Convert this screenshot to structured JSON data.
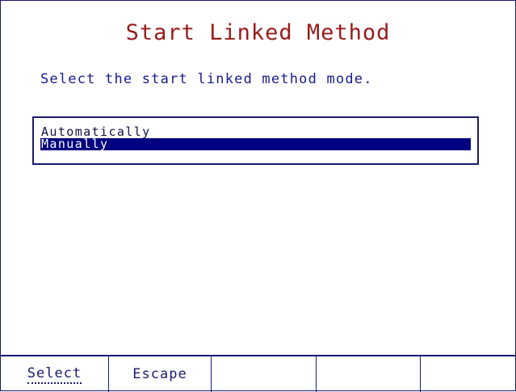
{
  "screen": {
    "title": "Start Linked Method",
    "prompt": "Select the start linked method mode."
  },
  "list": {
    "items": [
      {
        "label": "Automatically",
        "selected": false
      },
      {
        "label": "Manually",
        "selected": true
      }
    ]
  },
  "softkeys": [
    {
      "label": "Select",
      "active": true
    },
    {
      "label": "Escape",
      "active": false
    },
    {
      "label": "",
      "active": false
    },
    {
      "label": "",
      "active": false
    },
    {
      "label": "",
      "active": false
    }
  ],
  "colors": {
    "title": "#9a1a1a",
    "text": "#1a1a8c",
    "selection": "#000080",
    "border": "#1a1a6e"
  }
}
